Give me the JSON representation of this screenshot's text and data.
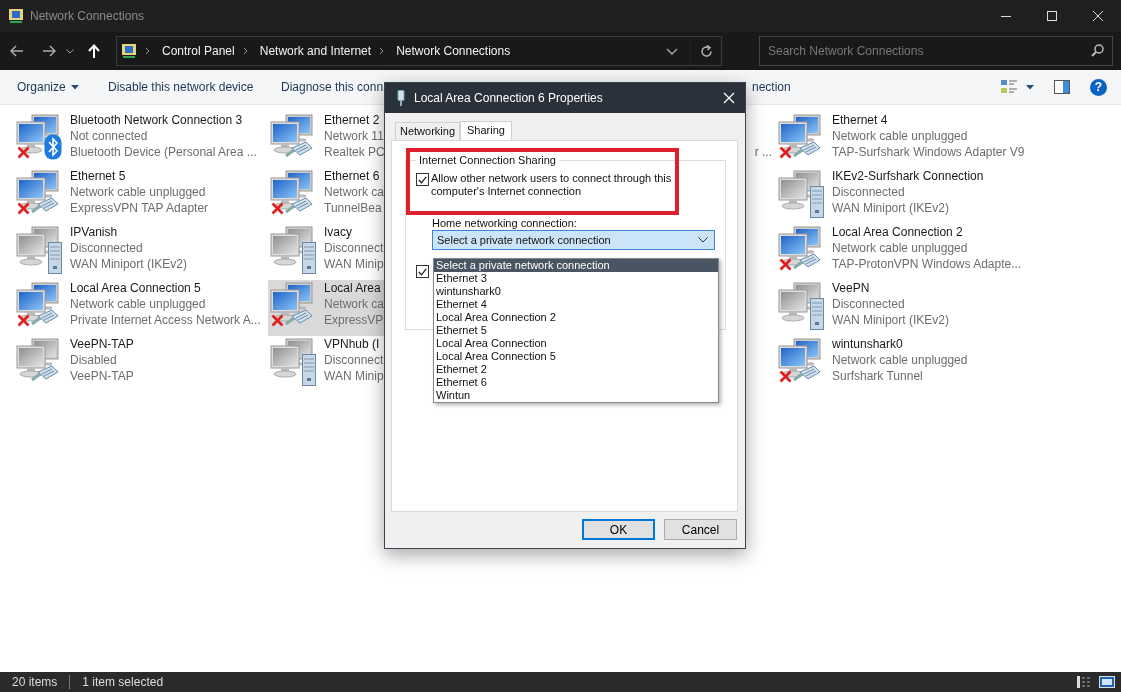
{
  "window": {
    "title": "Network Connections"
  },
  "address_bar": {
    "breadcrumbs": [
      "Control Panel",
      "Network and Internet",
      "Network Connections"
    ]
  },
  "search": {
    "placeholder": "Search Network Connections"
  },
  "command_bar": {
    "items": [
      {
        "label": "Organize",
        "kind": "menu"
      },
      {
        "label": "Disable this network device",
        "kind": "action"
      },
      {
        "label": "Diagnose this conn",
        "kind": "action"
      },
      {
        "label": "nection",
        "kind": "action"
      }
    ],
    "help": {
      "label": "?"
    }
  },
  "columns": [
    [
      {
        "name": "Bluetooth Network Connection 3",
        "status": "Not connected",
        "device": "Bluetooth Device (Personal Area ...",
        "kind": "bluetooth",
        "enabled": true,
        "unplugged": true,
        "selected": false
      },
      {
        "name": "Ethernet 5",
        "status": "Network cable unplugged",
        "device": "ExpressVPN TAP Adapter",
        "kind": "cable",
        "enabled": true,
        "unplugged": true,
        "selected": false
      },
      {
        "name": "IPVanish",
        "status": "Disconnected",
        "device": "WAN Miniport (IKEv2)",
        "kind": "miniport",
        "enabled": false,
        "unplugged": false,
        "selected": false
      },
      {
        "name": "Local Area Connection 5",
        "status": "Network cable unplugged",
        "device": "Private Internet Access Network A...",
        "kind": "cable",
        "enabled": true,
        "unplugged": true,
        "selected": false
      },
      {
        "name": "VeePN-TAP",
        "status": "Disabled",
        "device": "VeePN-TAP",
        "kind": "cable",
        "enabled": false,
        "unplugged": false,
        "selected": false
      }
    ],
    [
      {
        "name": "Ethernet 2",
        "status": "Network 11",
        "device": "Realtek PC",
        "kind": "cable",
        "enabled": true,
        "unplugged": false,
        "selected": false
      },
      {
        "name": "Ethernet 6",
        "status": "Network ca",
        "device": "TunnelBea",
        "kind": "cable",
        "enabled": true,
        "unplugged": true,
        "selected": false
      },
      {
        "name": "Ivacy",
        "status": "Disconnect",
        "device": "WAN Minip",
        "kind": "miniport",
        "enabled": false,
        "unplugged": false,
        "selected": false
      },
      {
        "name": "Local Area",
        "status": "Network ca",
        "device": "ExpressVP",
        "kind": "cable",
        "enabled": true,
        "unplugged": true,
        "selected": true
      },
      {
        "name": "VPNhub (I",
        "status": "Disconnect",
        "device": "WAN Minip",
        "kind": "miniport",
        "enabled": false,
        "unplugged": false,
        "selected": false
      }
    ],
    [
      {
        "device": "r ...",
        "kind": "hidden",
        "selected": false
      }
    ],
    [
      {
        "name": "Ethernet 4",
        "status": "Network cable unplugged",
        "device": "TAP-Surfshark Windows Adapter V9",
        "kind": "cable",
        "enabled": true,
        "unplugged": true,
        "selected": false
      },
      {
        "name": "IKEv2-Surfshark Connection",
        "status": "Disconnected",
        "device": "WAN Miniport (IKEv2)",
        "kind": "miniport",
        "enabled": false,
        "unplugged": false,
        "selected": false
      },
      {
        "name": "Local Area Connection 2",
        "status": "Network cable unplugged",
        "device": "TAP-ProtonVPN Windows Adapte...",
        "kind": "cable",
        "enabled": true,
        "unplugged": true,
        "selected": false
      },
      {
        "name": "VeePN",
        "status": "Disconnected",
        "device": "WAN Miniport (IKEv2)",
        "kind": "miniport",
        "enabled": false,
        "unplugged": false,
        "selected": false
      },
      {
        "name": "wintunshark0",
        "status": "Network cable unplugged",
        "device": "Surfshark Tunnel",
        "kind": "cable",
        "enabled": true,
        "unplugged": true,
        "selected": false
      }
    ]
  ],
  "dialog": {
    "title": "Local Area Connection 6 Properties",
    "tabs": [
      {
        "label": "Networking",
        "selected": false
      },
      {
        "label": "Sharing",
        "selected": true
      }
    ],
    "group_title": "Internet Connection Sharing",
    "allow_sharing": {
      "label": "Allow other network users to connect through this computer's Internet connection",
      "checked": true
    },
    "home_label": "Home networking connection:",
    "combo": {
      "value": "Select a private network connection"
    },
    "dropdown": [
      {
        "label": "Select a private network connection",
        "selected": true
      },
      {
        "label": "Ethernet 3",
        "selected": false
      },
      {
        "label": "wintunshark0",
        "selected": false
      },
      {
        "label": "Ethernet 4",
        "selected": false
      },
      {
        "label": "Local Area Connection 2",
        "selected": false
      },
      {
        "label": "Ethernet 5",
        "selected": false
      },
      {
        "label": "Local Area Connection",
        "selected": false
      },
      {
        "label": "Local Area Connection 5",
        "selected": false
      },
      {
        "label": "Ethernet 2",
        "selected": false
      },
      {
        "label": "Ethernet 6",
        "selected": false
      },
      {
        "label": "Wintun",
        "selected": false
      }
    ],
    "second_checkbox": {
      "checked": true
    },
    "buttons": [
      {
        "label": "OK",
        "default": true
      },
      {
        "label": "Cancel",
        "default": false
      }
    ]
  },
  "status_bar": {
    "items": [
      "20 items",
      "1 item selected"
    ]
  }
}
